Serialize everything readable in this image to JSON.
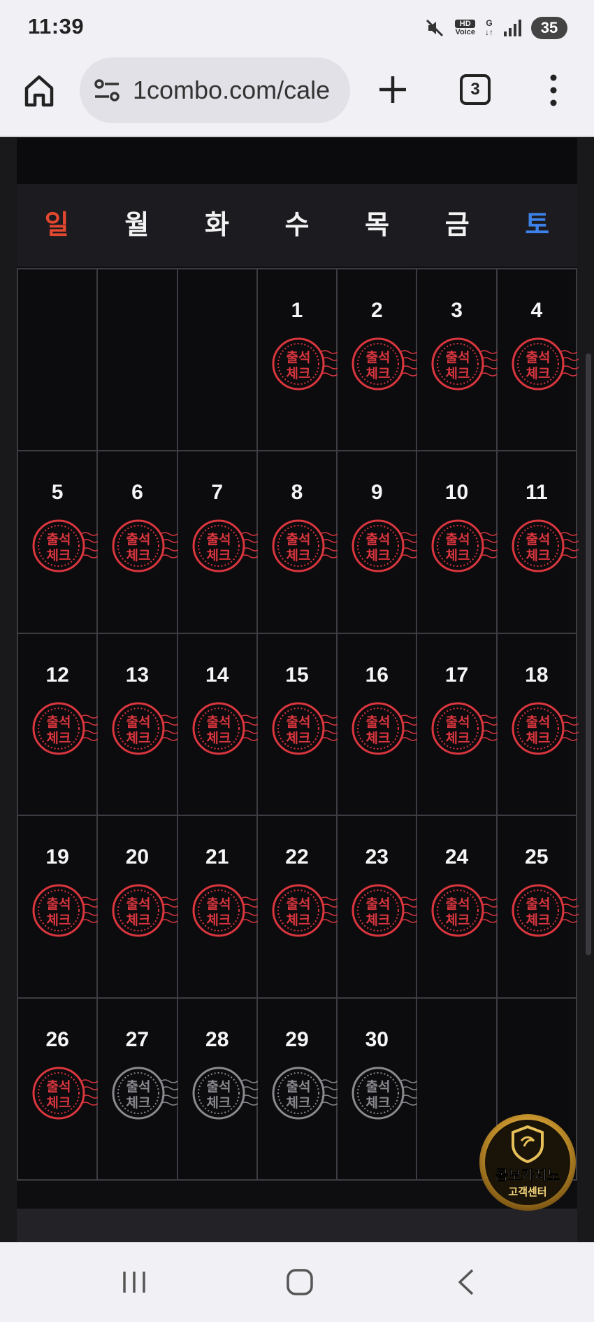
{
  "status_bar": {
    "time": "11:39",
    "hd_voice_top": "HD",
    "hd_voice_bottom": "Voice",
    "network": "G",
    "battery": "35"
  },
  "browser": {
    "url": "1combo.com/cale",
    "tab_count": "3"
  },
  "calendar": {
    "weekdays": [
      "일",
      "월",
      "화",
      "수",
      "목",
      "금",
      "토"
    ],
    "stamp_text_top": "출석",
    "stamp_text_bottom": "체크",
    "stamp_color_checked": "#d9363e",
    "stamp_color_unchecked": "#8a898e",
    "days": [
      {
        "day": "",
        "stamp": "none"
      },
      {
        "day": "",
        "stamp": "none"
      },
      {
        "day": "",
        "stamp": "none"
      },
      {
        "day": "1",
        "stamp": "checked"
      },
      {
        "day": "2",
        "stamp": "checked"
      },
      {
        "day": "3",
        "stamp": "checked"
      },
      {
        "day": "4",
        "stamp": "checked"
      },
      {
        "day": "5",
        "stamp": "checked"
      },
      {
        "day": "6",
        "stamp": "checked"
      },
      {
        "day": "7",
        "stamp": "checked"
      },
      {
        "day": "8",
        "stamp": "checked"
      },
      {
        "day": "9",
        "stamp": "checked"
      },
      {
        "day": "10",
        "stamp": "checked"
      },
      {
        "day": "11",
        "stamp": "checked"
      },
      {
        "day": "12",
        "stamp": "checked"
      },
      {
        "day": "13",
        "stamp": "checked"
      },
      {
        "day": "14",
        "stamp": "checked"
      },
      {
        "day": "15",
        "stamp": "checked"
      },
      {
        "day": "16",
        "stamp": "checked"
      },
      {
        "day": "17",
        "stamp": "checked"
      },
      {
        "day": "18",
        "stamp": "checked"
      },
      {
        "day": "19",
        "stamp": "checked"
      },
      {
        "day": "20",
        "stamp": "checked"
      },
      {
        "day": "21",
        "stamp": "checked"
      },
      {
        "day": "22",
        "stamp": "checked"
      },
      {
        "day": "23",
        "stamp": "checked"
      },
      {
        "day": "24",
        "stamp": "checked"
      },
      {
        "day": "25",
        "stamp": "checked"
      },
      {
        "day": "26",
        "stamp": "checked"
      },
      {
        "day": "27",
        "stamp": "unchecked"
      },
      {
        "day": "28",
        "stamp": "unchecked"
      },
      {
        "day": "29",
        "stamp": "unchecked"
      },
      {
        "day": "30",
        "stamp": "unchecked"
      },
      {
        "day": "",
        "stamp": "none"
      },
      {
        "day": "",
        "stamp": "none"
      }
    ]
  },
  "support_badge": {
    "line1": "콤보카지노",
    "line2": "고객센터",
    "gold": "#d4a93a"
  }
}
